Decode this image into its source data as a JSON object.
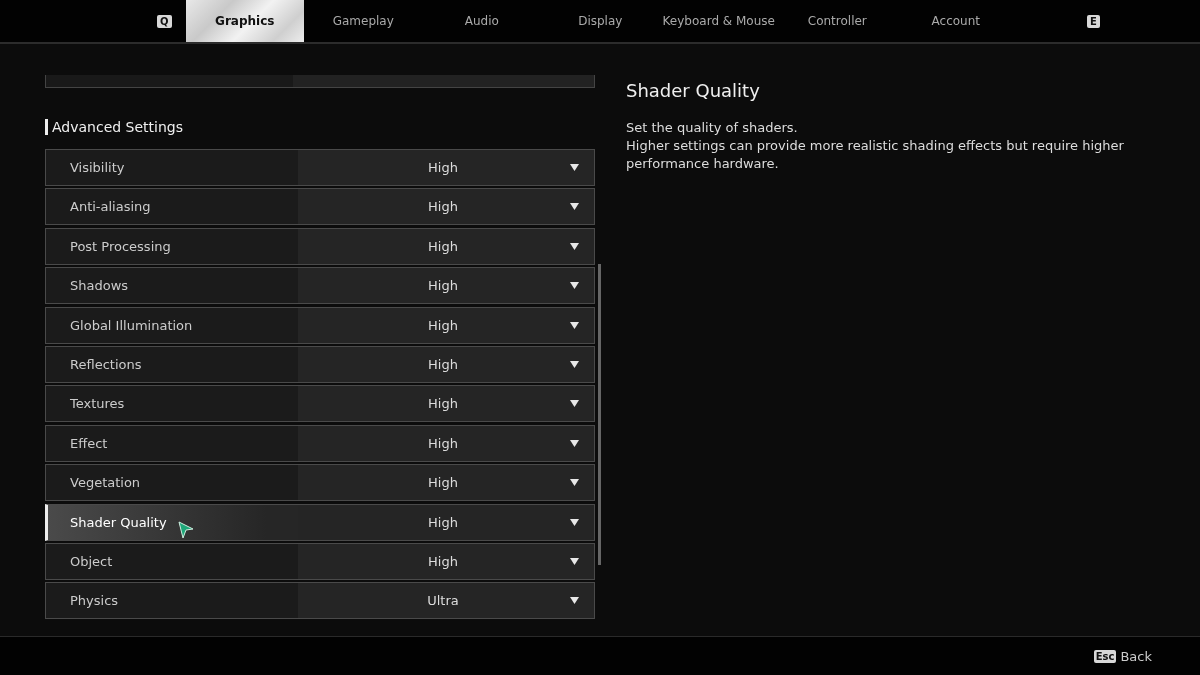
{
  "tabs": {
    "prev_key": "Q",
    "next_key": "E",
    "items": [
      {
        "label": "Graphics",
        "selected": true
      },
      {
        "label": "Gameplay",
        "selected": false
      },
      {
        "label": "Audio",
        "selected": false
      },
      {
        "label": "Display",
        "selected": false
      },
      {
        "label": "Keyboard & Mouse",
        "selected": false
      },
      {
        "label": "Controller",
        "selected": false
      },
      {
        "label": "Account",
        "selected": false
      }
    ]
  },
  "section": {
    "title": "Advanced Settings"
  },
  "settings": [
    {
      "label": "Visibility",
      "value": "High",
      "selected": false
    },
    {
      "label": "Anti-aliasing",
      "value": "High",
      "selected": false
    },
    {
      "label": "Post Processing",
      "value": "High",
      "selected": false
    },
    {
      "label": "Shadows",
      "value": "High",
      "selected": false
    },
    {
      "label": "Global Illumination",
      "value": "High",
      "selected": false
    },
    {
      "label": "Reflections",
      "value": "High",
      "selected": false
    },
    {
      "label": "Textures",
      "value": "High",
      "selected": false
    },
    {
      "label": "Effect",
      "value": "High",
      "selected": false
    },
    {
      "label": "Vegetation",
      "value": "High",
      "selected": false
    },
    {
      "label": "Shader Quality",
      "value": "High",
      "selected": true
    },
    {
      "label": "Object",
      "value": "High",
      "selected": false
    },
    {
      "label": "Physics",
      "value": "Ultra",
      "selected": false
    }
  ],
  "detail": {
    "title": "Shader Quality",
    "lines": [
      "Set the quality of shaders.",
      "Higher settings can provide more realistic shading effects but require higher performance hardware."
    ]
  },
  "footer": {
    "key": "Esc",
    "label": "Back"
  }
}
